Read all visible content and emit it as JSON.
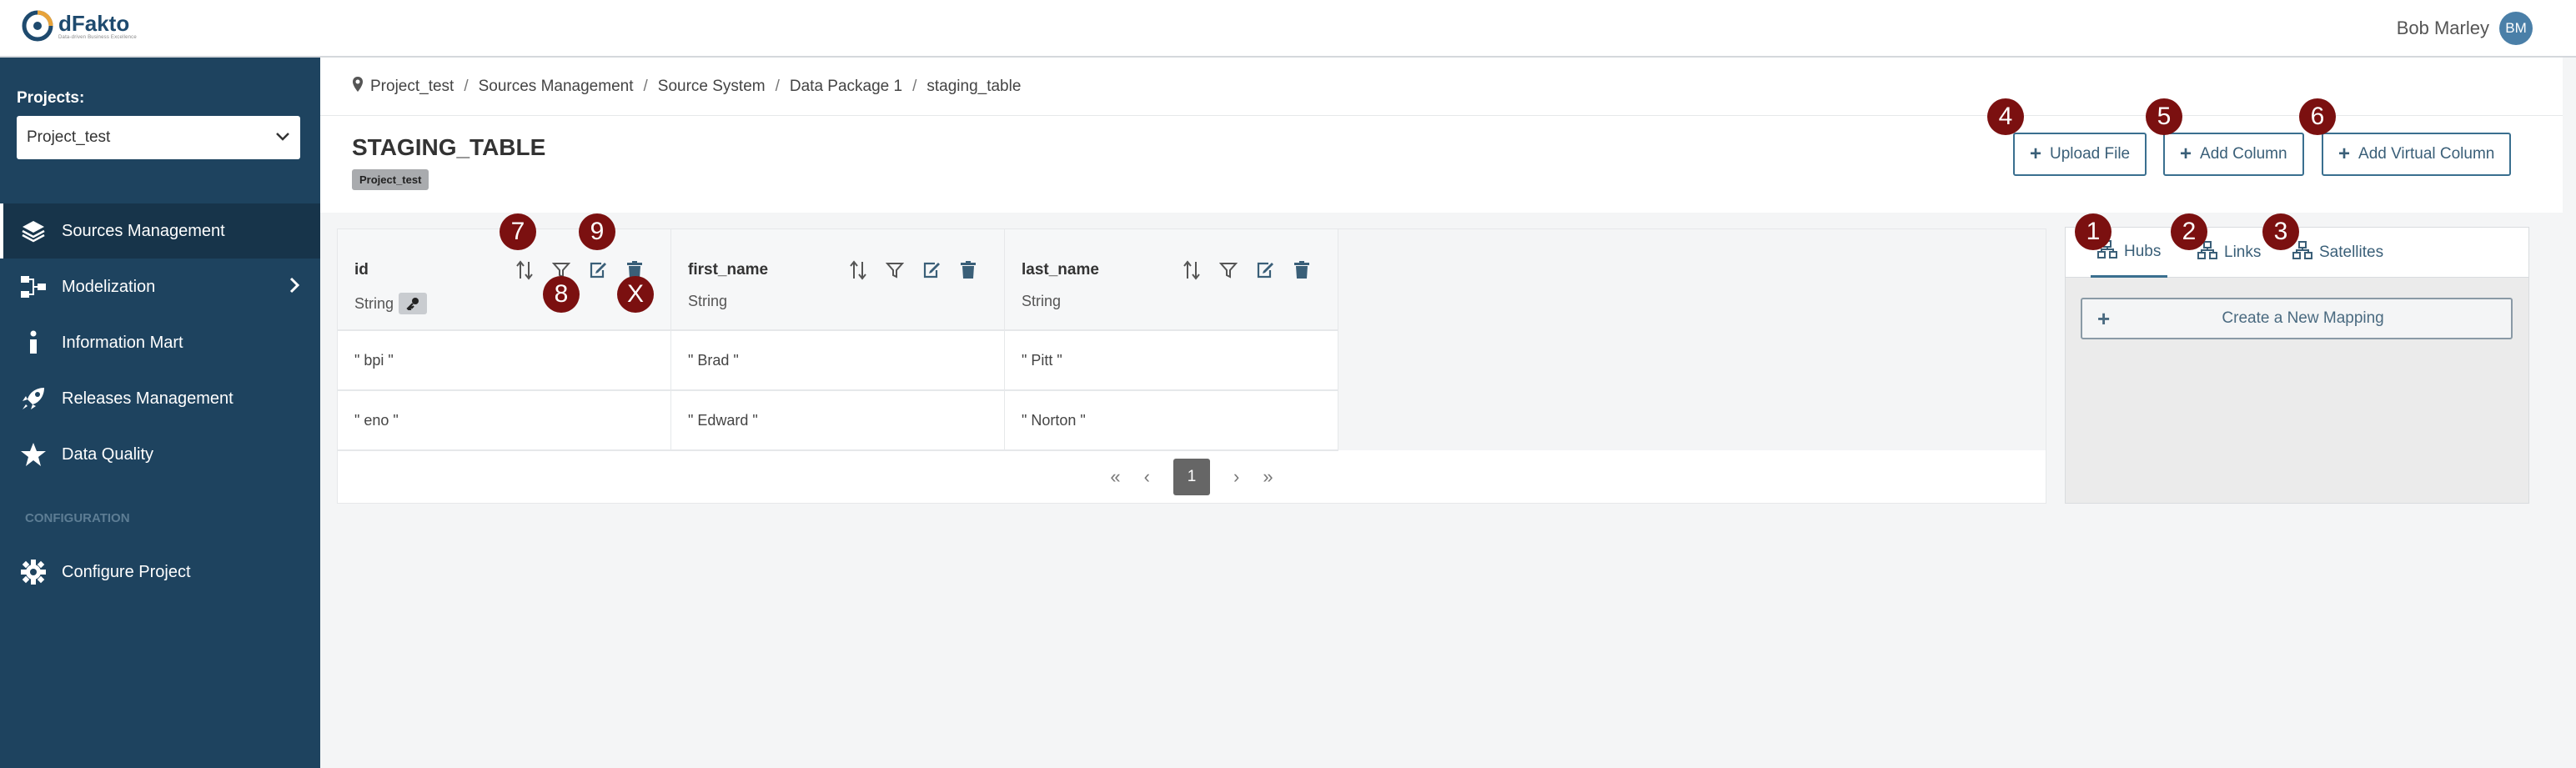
{
  "header": {
    "logo_name": "dFakto",
    "logo_tagline": "Data-driven Business Excellence",
    "user_name": "Bob Marley",
    "user_initials": "BM"
  },
  "sidebar": {
    "projects_label": "Projects:",
    "project_selected": "Project_test",
    "items": [
      {
        "label": "Sources Management",
        "icon": "layers-icon"
      },
      {
        "label": "Modelization",
        "icon": "hierarchy-icon"
      },
      {
        "label": "Information Mart",
        "icon": "info-icon"
      },
      {
        "label": "Releases Management",
        "icon": "rocket-icon"
      },
      {
        "label": "Data Quality",
        "icon": "star-icon"
      }
    ],
    "config_label": "CONFIGURATION",
    "config_item": "Configure Project"
  },
  "breadcrumb": [
    "Project_test",
    "Sources Management",
    "Source System",
    "Data Package 1",
    "staging_table"
  ],
  "page": {
    "title": "STAGING_TABLE",
    "badge": "Project_test"
  },
  "toolbar": {
    "upload_file": "Upload File",
    "add_column": "Add Column",
    "add_virtual_column": "Add Virtual Column"
  },
  "markers": {
    "hubs": "1",
    "links": "2",
    "satellites": "3",
    "upload": "4",
    "add_column": "5",
    "add_virtual": "6",
    "sort": "7",
    "filter": "8",
    "edit": "9",
    "delete": "X"
  },
  "table": {
    "columns": [
      {
        "name": "id",
        "type": "String"
      },
      {
        "name": "first_name",
        "type": "String"
      },
      {
        "name": "last_name",
        "type": "String"
      }
    ],
    "rows": [
      [
        "\" bpi \"",
        "\" Brad \"",
        "\" Pitt \""
      ],
      [
        "\" eno \"",
        "\" Edward \"",
        "\" Norton \""
      ]
    ],
    "pagination": {
      "first": "«",
      "prev": "‹",
      "current": "1",
      "next": "›",
      "last": "»"
    }
  },
  "panel": {
    "tabs": [
      "Hubs",
      "Links",
      "Satellites"
    ],
    "active_tab": "Hubs",
    "create_mapping": "Create a New Mapping"
  },
  "colors": {
    "sidebar": "#1e435f",
    "accent": "#3a6f8f",
    "marker": "#7b1010"
  }
}
